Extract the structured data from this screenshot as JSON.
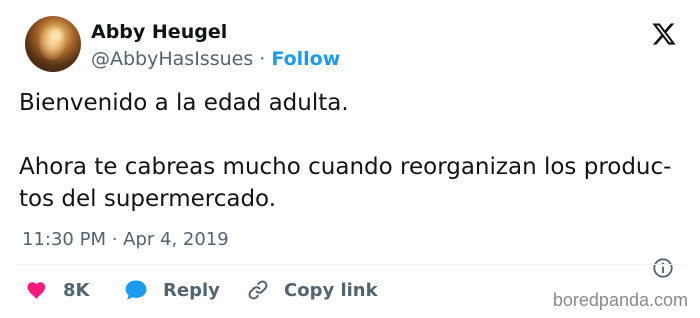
{
  "author": {
    "name": "Abby Heugel",
    "handle": "@AbbyHasIssues",
    "separator": "·",
    "follow_label": "Follow"
  },
  "tweet": {
    "paragraphs": [
      "Bienvenido a la edad adulta.",
      "Ahora te cabreas mucho cuando reorganizan los produc-",
      "tos del supermercado."
    ],
    "timestamp": "11:30 PM · Apr 4, 2019"
  },
  "actions": {
    "like_count": "8K",
    "reply_label": "Reply",
    "copy_label": "Copy link"
  },
  "watermark": "boredpanda.com",
  "icons": {
    "logo": "x-logo-icon",
    "info": "info-icon",
    "heart": "heart-icon",
    "reply": "reply-bubble-icon",
    "link": "link-icon"
  },
  "colors": {
    "accent": "#1d9bf0",
    "like": "#f91880",
    "secondary_text": "#536471"
  }
}
